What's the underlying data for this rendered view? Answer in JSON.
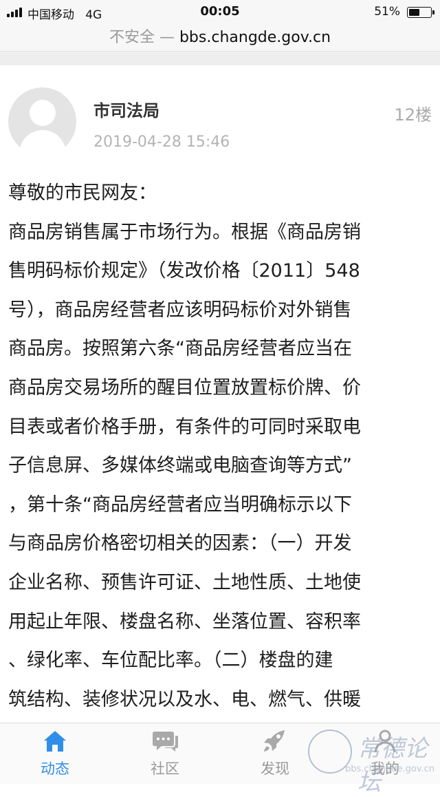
{
  "status_bar": {
    "carrier": "中国移动",
    "network": "4G",
    "time": "00:05",
    "battery_percent": "51%",
    "battery_level": 0.51
  },
  "address_bar": {
    "insecure_label": "不安全",
    "separator": "—",
    "domain": "bbs.changde.gov.cn"
  },
  "post": {
    "author": "市司法局",
    "floor": "12楼",
    "timestamp": "2019-04-28 15:46",
    "lines": [
      "尊敬的市民网友：",
      "商品房销售属于市场行为。根据《商品房销",
      "售明码标价规定》（发改价格〔2011〕548",
      "号），商品房经营者应该明码标价对外销售",
      "商品房。按照第六条“商品房经营者应当在",
      "商品房交易场所的醒目位置放置标价牌、价",
      "目表或者价格手册，有条件的可同时采取电",
      "子信息屏、多媒体终端或电脑查询等方式”",
      "，第十条“商品房经营者应当明确标示以下",
      "与商品房价格密切相关的因素：（一）开发",
      "企业名称、预售许可证、土地性质、土地使",
      "用起止年限、楼盘名称、坐落位置、容积率",
      "、绿化率、车位配比率。（二）楼盘的建",
      "筑结构、装修状况以及水、电、燃气、供暖"
    ]
  },
  "tab_bar": {
    "accent_color": "#2f8fe8",
    "tabs": [
      {
        "label": "动态",
        "icon": "home-icon",
        "active": true
      },
      {
        "label": "社区",
        "icon": "chat-icon",
        "active": false
      },
      {
        "label": "发现",
        "icon": "rocket-icon",
        "active": false
      },
      {
        "label": "我的",
        "icon": "user-icon",
        "active": false
      }
    ]
  },
  "watermark": {
    "text": "常德论坛",
    "url": "bbs.changde.gov.cn"
  }
}
